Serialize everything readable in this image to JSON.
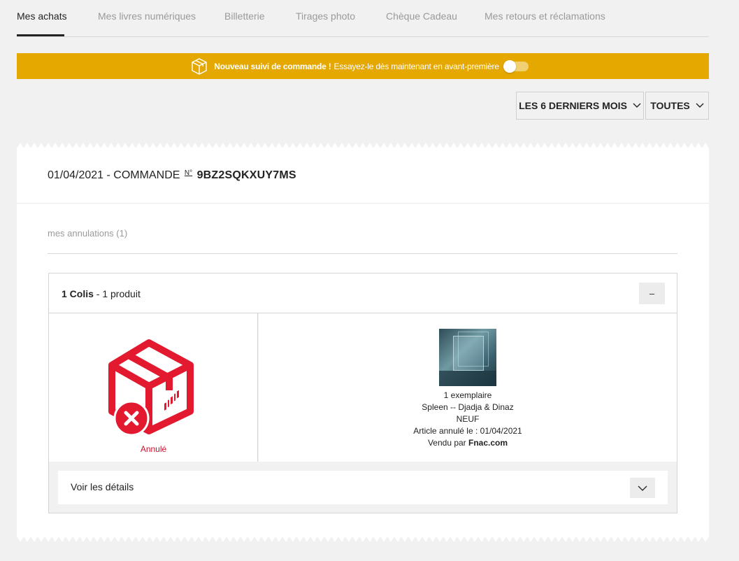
{
  "tabs": [
    {
      "label": "Mes achats",
      "active": true
    },
    {
      "label": "Mes livres numériques",
      "active": false
    },
    {
      "label": "Billetterie",
      "active": false
    },
    {
      "label": "Tirages photo",
      "active": false
    },
    {
      "label": "Chèque Cadeau",
      "active": false
    },
    {
      "label": "Mes retours et réclamations",
      "active": false
    }
  ],
  "banner": {
    "bold_text": "Nouveau suivi de commande !",
    "text": "Essayez-le dès maintenant en avant-première",
    "icon": "package-icon",
    "toggle_on": false,
    "color": "#e5a800"
  },
  "filters": {
    "period": "LES 6 DERNIERS MOIS",
    "type": "TOUTES"
  },
  "order": {
    "date": "01/04/2021",
    "label": "- COMMANDE",
    "no_symbol": "N°",
    "number": "9BZ2SQKXUY7MS"
  },
  "section": {
    "label": "mes annulations (1)"
  },
  "package": {
    "colis_label": "1 Colis",
    "produit_label": "- 1 produit",
    "collapse_label": "–",
    "status": "Annulé",
    "status_color": "#c8102e",
    "icon": "cancelled-package-icon"
  },
  "product": {
    "quantity": "1 exemplaire",
    "title": "Spleen -- Djadja & Dinaz",
    "condition": "NEUF",
    "cancelled": "Article annulé le : 01/04/2021",
    "sold_by_prefix": "Vendu par",
    "seller": "Fnac.com"
  },
  "details": {
    "label": "Voir les détails"
  }
}
